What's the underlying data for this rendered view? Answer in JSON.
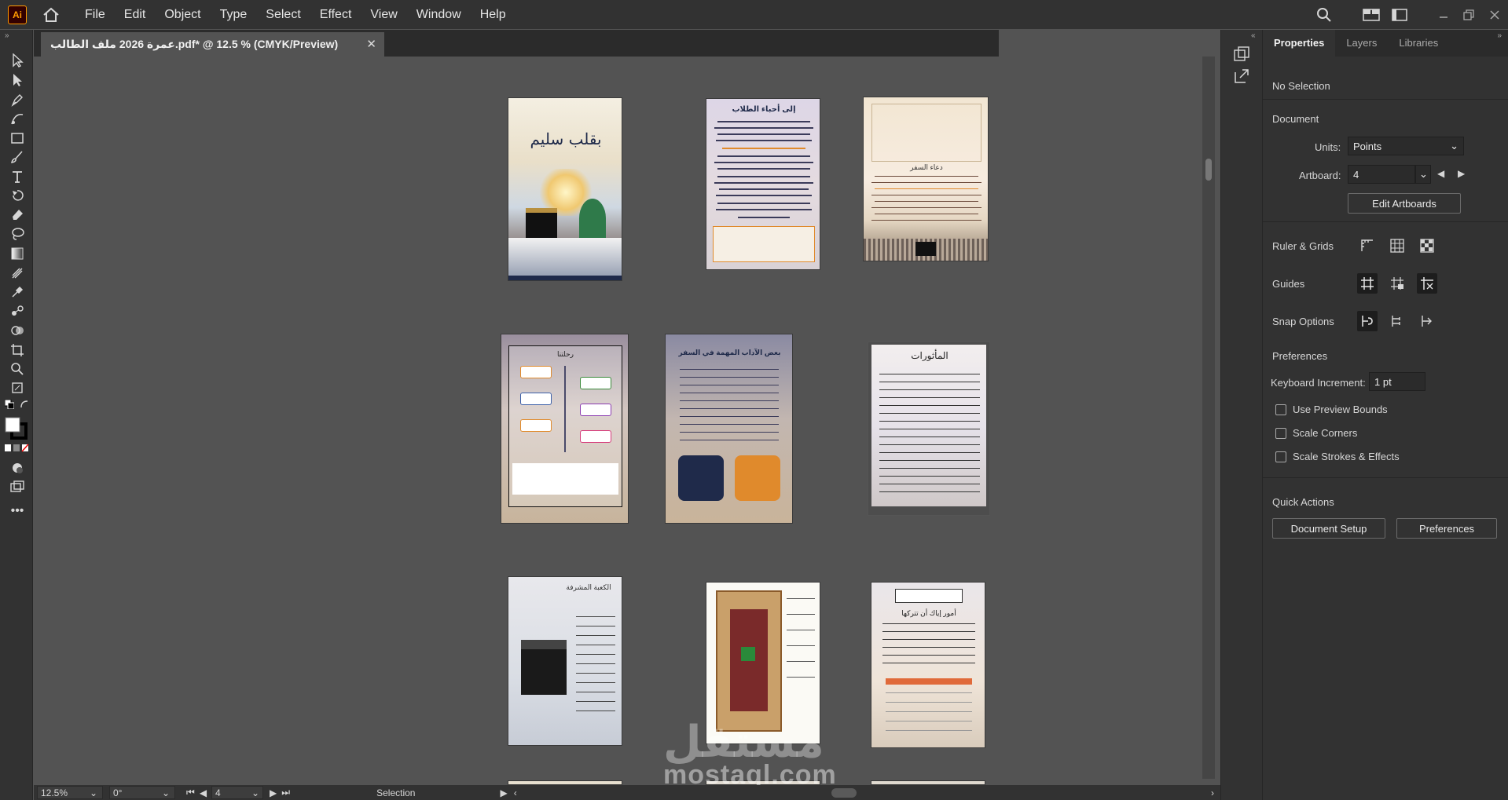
{
  "app": {
    "logo_text": "Ai"
  },
  "menu": [
    "File",
    "Edit",
    "Object",
    "Type",
    "Select",
    "Effect",
    "View",
    "Window",
    "Help"
  ],
  "document": {
    "tab_title": "عمرة 2026 ملف الطالب.pdf* @ 12.5 % (CMYK/Preview)"
  },
  "status": {
    "zoom": "12.5%",
    "rotation": "0°",
    "artboard_nav": "4",
    "tool": "Selection"
  },
  "properties": {
    "tabs": [
      "Properties",
      "Layers",
      "Libraries"
    ],
    "selection": "No Selection",
    "document_label": "Document",
    "units_label": "Units:",
    "units_value": "Points",
    "artboard_label": "Artboard:",
    "artboard_value": "4",
    "edit_artboards": "Edit Artboards",
    "ruler_grids": "Ruler & Grids",
    "guides": "Guides",
    "snap_options": "Snap Options",
    "preferences_label": "Preferences",
    "keyboard_increment_label": "Keyboard Increment:",
    "keyboard_increment_value": "1 pt",
    "use_preview_bounds": "Use Preview Bounds",
    "scale_corners": "Scale Corners",
    "scale_strokes": "Scale Strokes & Effects",
    "quick_actions": "Quick Actions",
    "document_setup": "Document Setup",
    "preferences_btn": "Preferences"
  },
  "artboard_text": {
    "ab1_title": "بقلب سليم",
    "ab2_title": "إلى أحباء الطلاب",
    "ab3_title": "دعاء السفر",
    "ab4_title": "رحلتنا",
    "ab5_title": "بعض الآداب المهمة في السفر",
    "ab6_title": "المأثورات",
    "ab7_title": "الكعبة المشرفة",
    "ab9_title": "أمور إياك أن تتركها"
  },
  "watermark": {
    "brand": "مستقل",
    "domain": "mostaql.com"
  },
  "colors": {
    "accent": "#e08a2c",
    "artboard_sky": "#d8d0c8",
    "navy": "#1f2a4a"
  }
}
